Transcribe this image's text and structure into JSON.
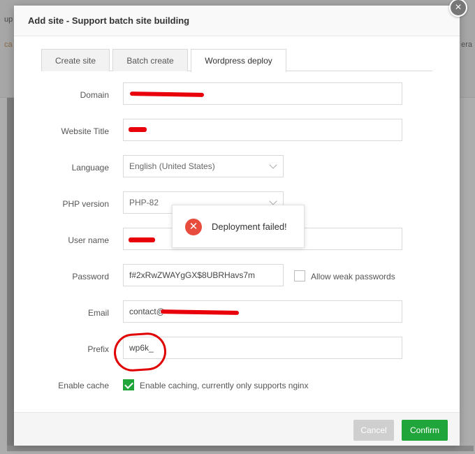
{
  "background": {
    "left_fragment_top": "up",
    "left_fragment_mid": "ca",
    "right_fragment": "era"
  },
  "modal": {
    "title": "Add site - Support batch site building",
    "close_glyph": "×"
  },
  "tabs": [
    {
      "label": "Create site",
      "active": false
    },
    {
      "label": "Batch create",
      "active": false
    },
    {
      "label": "Wordpress deploy",
      "active": true
    }
  ],
  "form": {
    "domain": {
      "label": "Domain",
      "value": ""
    },
    "website_title": {
      "label": "Website Title",
      "value": ""
    },
    "language": {
      "label": "Language",
      "value": "English (United States)"
    },
    "php_version": {
      "label": "PHP version",
      "value": "PHP-82"
    },
    "user_name": {
      "label": "User name",
      "value": ""
    },
    "password": {
      "label": "Password",
      "value": "f#2xRwZWAYgGX$8UBRHavs7m"
    },
    "allow_weak": {
      "label": "Allow weak passwords",
      "checked": false
    },
    "email": {
      "label": "Email",
      "value": "contact@"
    },
    "prefix": {
      "label": "Prefix",
      "value": "wp6k_"
    },
    "enable_cache": {
      "label": "Enable cache",
      "checkbox_label": "Enable caching, currently only supports nginx",
      "checked": true
    }
  },
  "toast": {
    "message": "Deployment failed!",
    "icon": "error-x-icon"
  },
  "footer": {
    "cancel_label": "Cancel",
    "confirm_label": "Confirm"
  },
  "colors": {
    "accent_green": "#20a53a",
    "error_red": "#e84c3d",
    "redaction_red": "#e8000a"
  }
}
